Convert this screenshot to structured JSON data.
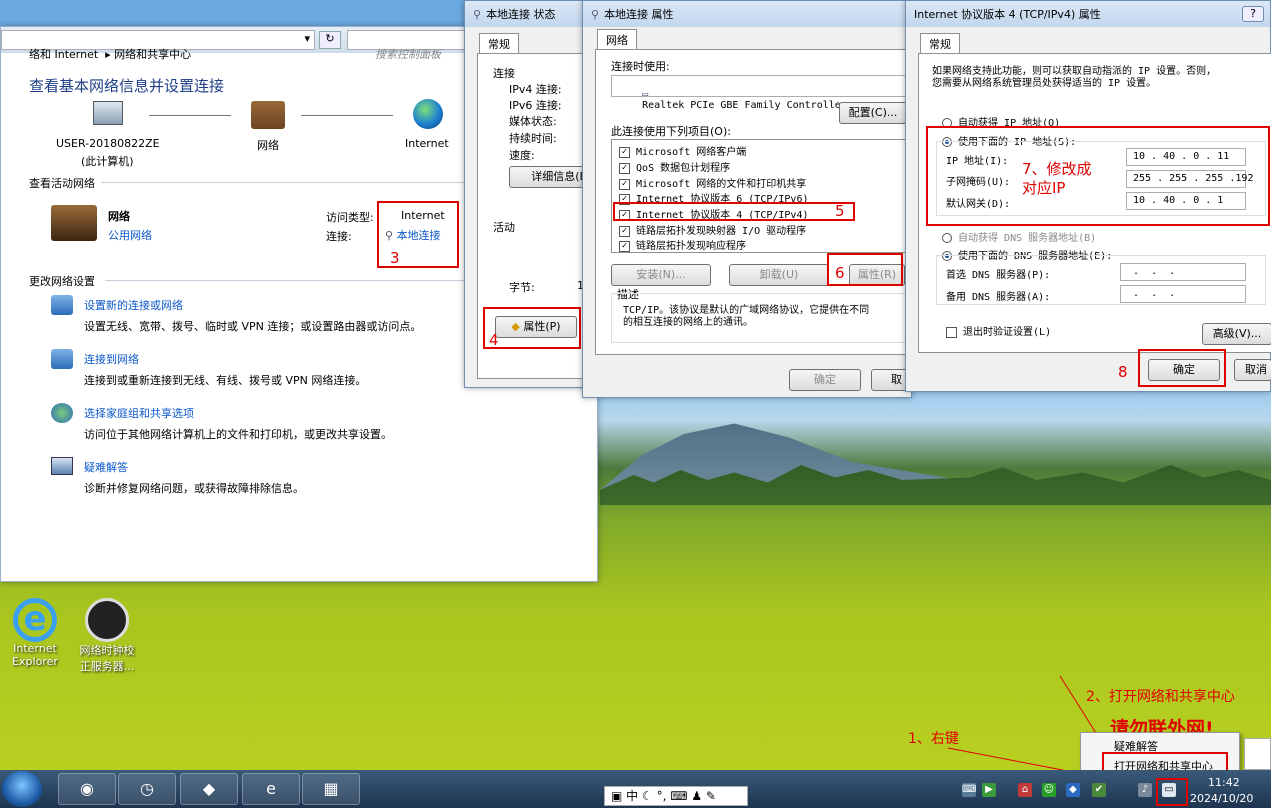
{
  "network_center": {
    "address": "络和 Internet  ▸ 网络和共享中心",
    "search_placeholder": "搜索控制面板",
    "heading": "查看基本网络信息并设置连接",
    "computer_name": "USER-20180822ZE",
    "computer_sub": "(此计算机)",
    "network_label": "网络",
    "internet_label": "Internet",
    "active_heading": "查看活动网络",
    "active_network_name": "网络",
    "active_network_type": "公用网络",
    "access_type_label": "访问类型:",
    "access_type_value": "Internet",
    "connection_label": "连接:",
    "connection_value": "本地连接",
    "change_heading": "更改网络设置",
    "tasks": [
      {
        "title": "设置新的连接或网络",
        "desc": "设置无线、宽带、拨号、临时或 VPN 连接；或设置路由器或访问点。"
      },
      {
        "title": "连接到网络",
        "desc": "连接到或重新连接到无线、有线、拨号或 VPN 网络连接。"
      },
      {
        "title": "选择家庭组和共享选项",
        "desc": "访问位于其他网络计算机上的文件和打印机，或更改共享设置。"
      },
      {
        "title": "疑难解答",
        "desc": "诊断并修复网络问题，或获得故障排除信息。"
      }
    ]
  },
  "status_window": {
    "title": "本地连接 状态",
    "tab": "常规",
    "connection_group": "连接",
    "rows": [
      "IPv4 连接:",
      "IPv6 连接:",
      "媒体状态:",
      "持续时间:",
      "速度:"
    ],
    "details_button": "详细信息(E)",
    "activity_group": "活动",
    "bytes_label": "字节:",
    "bytes_value": "1",
    "properties_button": "属性(P)"
  },
  "props_window": {
    "title": "本地连接 属性",
    "tab": "网络",
    "connect_using_label": "连接时使用:",
    "adapter": "Realtek PCIe GBE Family Controller",
    "configure_button": "配置(C)...",
    "items_label": "此连接使用下列项目(O):",
    "items": [
      "Microsoft 网络客户端",
      "QoS 数据包计划程序",
      "Microsoft 网络的文件和打印机共享",
      "Internet 协议版本 6 (TCP/IPv6)",
      "Internet 协议版本 4 (TCP/IPv4)",
      "链路层拓扑发现映射器 I/O 驱动程序",
      "链路层拓扑发现响应程序"
    ],
    "install_button": "安装(N)...",
    "uninstall_button": "卸载(U)",
    "properties_button": "属性(R)",
    "desc_group": "描述",
    "desc_text_1": "TCP/IP。该协议是默认的广域网络协议，它提供在不同",
    "desc_text_2": "的相互连接的网络上的通讯。",
    "ok_button": "确定",
    "cancel_partial": "取"
  },
  "ipv4_window": {
    "title": "Internet 协议版本 4 (TCP/IPv4) 属性",
    "help": "?",
    "tab": "常规",
    "intro_1": "如果网络支持此功能，则可以获取自动指派的 IP 设置。否则，",
    "intro_2": "您需要从网络系统管理员处获得适当的 IP 设置。",
    "auto_ip": "自动获得 IP 地址(O)",
    "manual_ip": "使用下面的 IP 地址(S):",
    "ip_label": "IP 地址(I):",
    "ip_value": "10 . 40 . 0 . 11",
    "mask_label": "子网掩码(U):",
    "mask_value": "255 . 255 . 255 .192",
    "gateway_label": "默认网关(D):",
    "gateway_value": "10 . 40 . 0 . 1",
    "auto_dns": "自动获得 DNS 服务器地址(B)",
    "manual_dns": "使用下面的 DNS 服务器地址(E):",
    "dns1_label": "首选 DNS 服务器(P):",
    "dns2_label": "备用 DNS 服务器(A):",
    "dns_empty": " .  .  . ",
    "validate": "退出时验证设置(L)",
    "advanced_button": "高级(V)...",
    "ok_button": "确定",
    "cancel_partial": "取消"
  },
  "annotations": {
    "n1": "1、右键",
    "n2": "2、打开网络和共享中心",
    "n3": "3",
    "n4": "4",
    "n5": "5",
    "n6": "6",
    "n7_1": "7、修改成",
    "n7_2": "对应IP",
    "n8": "8",
    "warning": "请勿联外网!"
  },
  "context_menu": {
    "item1": "疑难解答",
    "item2": "打开网络和共享中心"
  },
  "desktop": {
    "ie_label_1": "Internet",
    "ie_label_2": "Explorer",
    "clock_label_1": "网络时钟校",
    "clock_label_2": "正服务器..."
  },
  "taskbar": {
    "time": "11:42",
    "date": "2024/10/20",
    "ime": "中"
  },
  "colors": {
    "accent_red": "#e00000",
    "link_blue": "#0c59c9"
  }
}
